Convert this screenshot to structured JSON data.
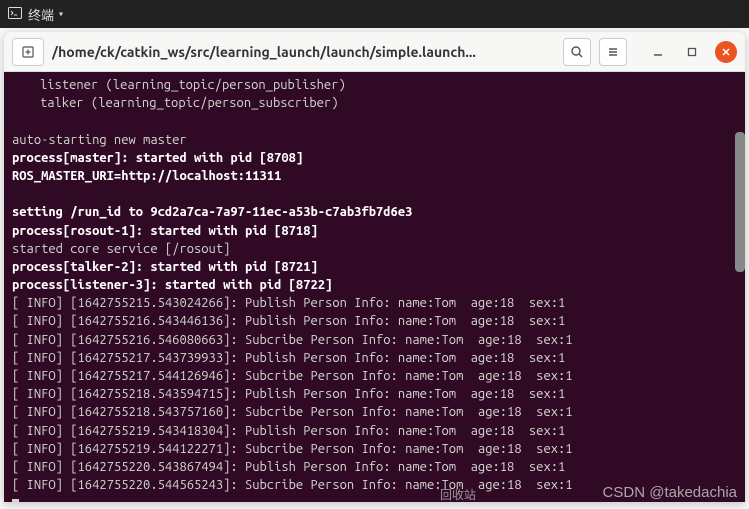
{
  "topbar": {
    "label": "终端",
    "arrow": "▾"
  },
  "window": {
    "title": "/home/ck/catkin_ws/src/learning_launch/launch/simple.launch..."
  },
  "terminal": {
    "lines": [
      {
        "cls": "indent",
        "text": "listener (learning_topic/person_publisher)"
      },
      {
        "cls": "indent",
        "text": "talker (learning_topic/person_subscriber)"
      },
      {
        "cls": "",
        "text": ""
      },
      {
        "cls": "",
        "text": "auto-starting new master"
      },
      {
        "cls": "bold",
        "text": "process[master]: started with pid [8708]"
      },
      {
        "cls": "bold",
        "text": "ROS_MASTER_URI=http://localhost:11311"
      },
      {
        "cls": "",
        "text": ""
      },
      {
        "cls": "bold",
        "text": "setting /run_id to 9cd2a7ca-7a97-11ec-a53b-c7ab3fb7d6e3"
      },
      {
        "cls": "bold",
        "text": "process[rosout-1]: started with pid [8718]"
      },
      {
        "cls": "",
        "text": "started core service [/rosout]"
      },
      {
        "cls": "bold",
        "text": "process[talker-2]: started with pid [8721]"
      },
      {
        "cls": "bold",
        "text": "process[listener-3]: started with pid [8722]"
      },
      {
        "cls": "",
        "text": "[ INFO] [1642755215.543024266]: Publish Person Info: name:Tom  age:18  sex:1"
      },
      {
        "cls": "",
        "text": "[ INFO] [1642755216.543446136]: Publish Person Info: name:Tom  age:18  sex:1"
      },
      {
        "cls": "",
        "text": "[ INFO] [1642755216.546080663]: Subcribe Person Info: name:Tom  age:18  sex:1"
      },
      {
        "cls": "",
        "text": "[ INFO] [1642755217.543739933]: Publish Person Info: name:Tom  age:18  sex:1"
      },
      {
        "cls": "",
        "text": "[ INFO] [1642755217.544126946]: Subcribe Person Info: name:Tom  age:18  sex:1"
      },
      {
        "cls": "",
        "text": "[ INFO] [1642755218.543594715]: Publish Person Info: name:Tom  age:18  sex:1"
      },
      {
        "cls": "",
        "text": "[ INFO] [1642755218.543757160]: Subcribe Person Info: name:Tom  age:18  sex:1"
      },
      {
        "cls": "",
        "text": "[ INFO] [1642755219.543418304]: Publish Person Info: name:Tom  age:18  sex:1"
      },
      {
        "cls": "",
        "text": "[ INFO] [1642755219.544122271]: Subcribe Person Info: name:Tom  age:18  sex:1"
      },
      {
        "cls": "",
        "text": "[ INFO] [1642755220.543867494]: Publish Person Info: name:Tom  age:18  sex:1"
      },
      {
        "cls": "",
        "text": "[ INFO] [1642755220.544565243]: Subcribe Person Info: name:Tom  age:18  sex:1"
      }
    ]
  },
  "watermark": "CSDN @takedachia",
  "recycle": "回收站"
}
